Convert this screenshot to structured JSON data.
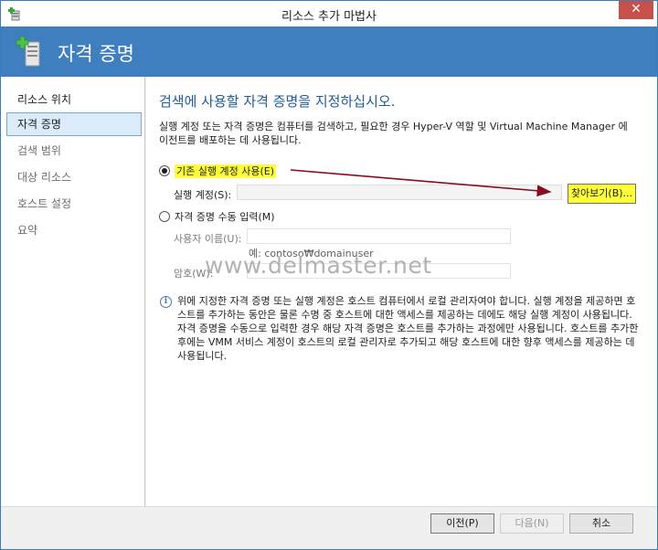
{
  "window": {
    "title": "리소스 추가 마법사",
    "close_label": "✕"
  },
  "banner": {
    "title": "자격 증명"
  },
  "nav": {
    "items": [
      {
        "label": "리소스 위치"
      },
      {
        "label": "자격 증명"
      },
      {
        "label": "검색 범위"
      },
      {
        "label": "대상 리소스"
      },
      {
        "label": "호스트 설정"
      },
      {
        "label": "요약"
      }
    ]
  },
  "main": {
    "heading": "검색에 사용할 자격 증명을 지정하십시오.",
    "description": "실행 계정 또는 자격 증명은 컴퓨터를 검색하고, 필요한 경우 Hyper-V 역할 및 Virtual Machine Manager 에이전트를 배포하는 데 사용됩니다.",
    "option_existing": "기존 실행 계정 사용(E)",
    "runas_label": "실행 계정(S):",
    "runas_value": "",
    "browse_label": "찾아보기(B)...",
    "option_manual": "자격 증명 수동 입력(M)",
    "username_label": "사용자 이름(U):",
    "username_value": "",
    "username_hint": "예: contoso₩domainuser",
    "password_label": "암호(W):",
    "password_value": "",
    "watermark": "www.delmaster.net",
    "info_text": "위에 지정한 자격 증명 또는 실행 계정은 호스트 컴퓨터에서 로컬 관리자여야 합니다. 실행 계정을 제공하면 호스트를 추가하는 동안은 물론 수명 중 호스트에 대한 액세스를 제공하는 데에도 해당 실행 계정이 사용됩니다. 자격 증명을 수동으로 입력한 경우 해당 자격 증명은 호스트를 추가하는 과정에만 사용됩니다. 호스트를 추가한 후에는 VMM 서비스 계정이 호스트의 로컬 관리자로 추가되고 해당 호스트에 대한 향후 액세스를 제공하는 데 사용됩니다."
  },
  "footer": {
    "prev_label": "이전(P)",
    "next_label": "다음(N)",
    "cancel_label": "취소"
  },
  "colors": {
    "banner": "#3f7fbf",
    "heading": "#1f5b95",
    "highlight": "#ffff3a",
    "arrow": "#8b0a1e"
  }
}
